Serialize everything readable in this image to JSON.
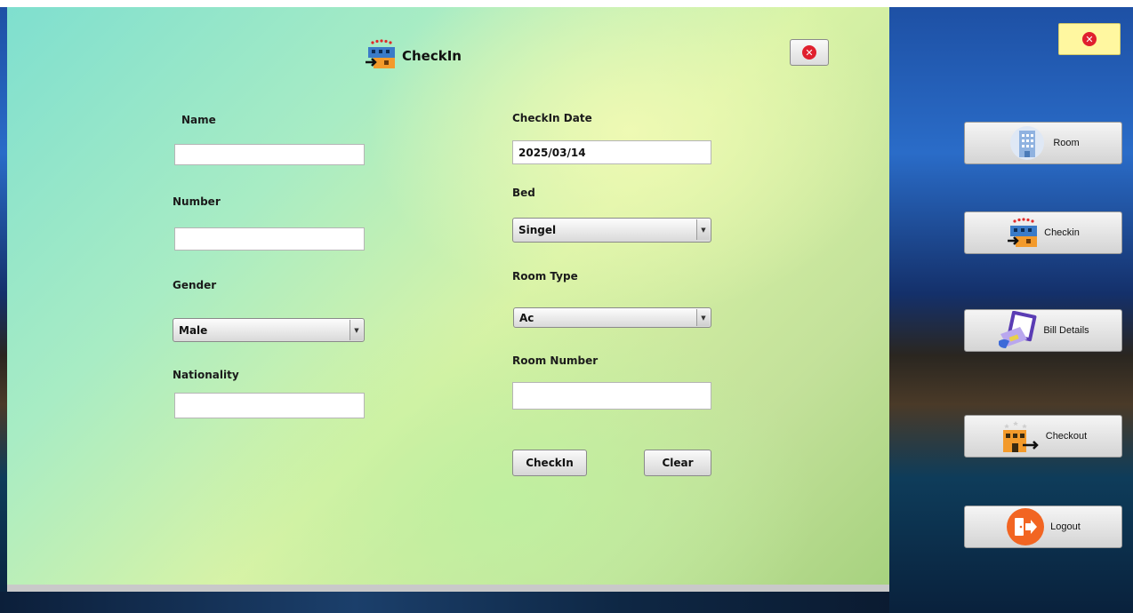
{
  "form": {
    "title": "CheckIn",
    "close_icon": "close-icon",
    "fields": {
      "name": {
        "label": "Name",
        "value": ""
      },
      "number": {
        "label": "Number",
        "value": ""
      },
      "gender": {
        "label": "Gender",
        "value": "Male"
      },
      "nationality": {
        "label": "Nationality",
        "value": ""
      },
      "checkin_date": {
        "label": "CheckIn Date",
        "value": "2025/03/14"
      },
      "bed": {
        "label": "Bed",
        "value": "Singel"
      },
      "room_type": {
        "label": "Room Type",
        "value": "Ac"
      },
      "room_number": {
        "label": "Room Number",
        "value": ""
      }
    },
    "buttons": {
      "checkin": "CheckIn",
      "clear": "Clear"
    }
  },
  "sidebar": {
    "close_icon": "close-icon",
    "items": [
      {
        "label": "Room",
        "icon": "room-building-icon"
      },
      {
        "label": "Checkin",
        "icon": "hotel-checkin-icon"
      },
      {
        "label": "Bill Details",
        "icon": "bill-card-icon"
      },
      {
        "label": "Checkout",
        "icon": "hotel-checkout-icon"
      },
      {
        "label": "Logout",
        "icon": "logout-door-icon"
      }
    ]
  },
  "colors": {
    "close_red": "#e0202e",
    "logout_orange": "#f26522",
    "sidebar_close_bg": "#fff7a0"
  }
}
